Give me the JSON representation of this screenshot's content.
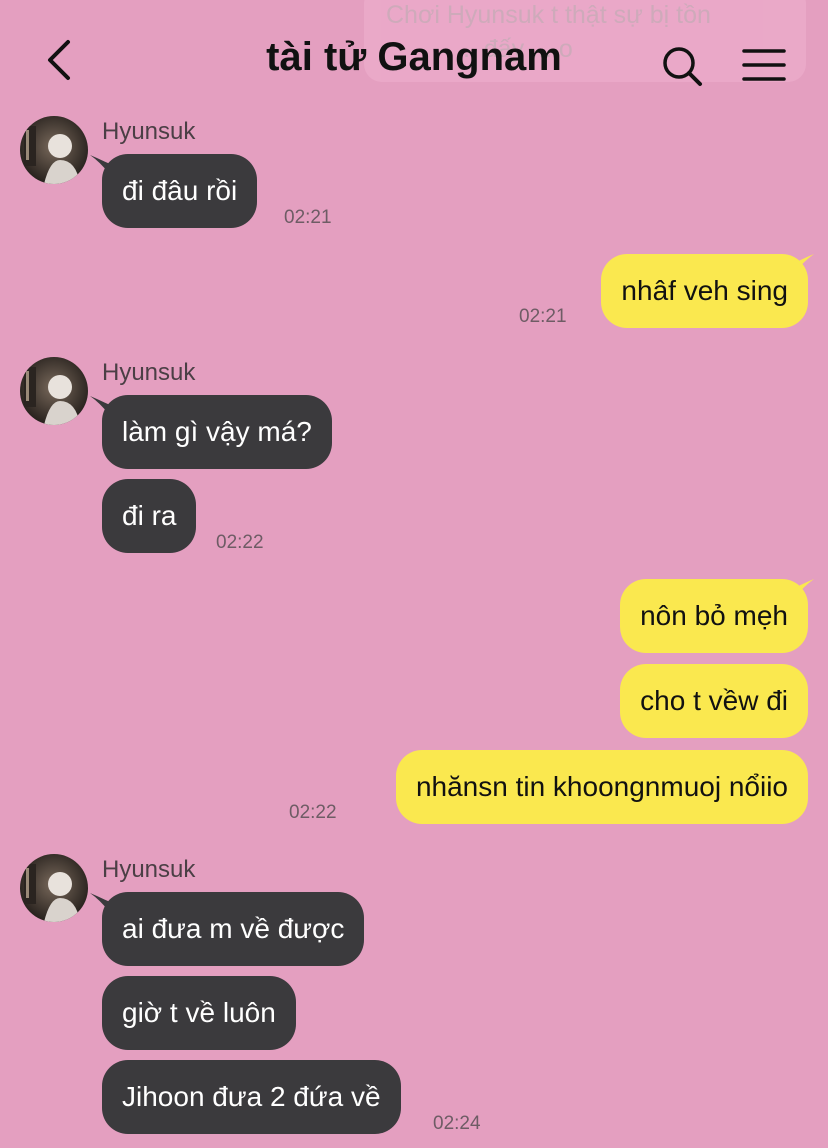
{
  "header": {
    "title": "tài tử Gangnam"
  },
  "notification_ghost": {
    "line1": "Chơi Hyunsuk t thật sự bị tồn",
    "line2": "... đấy ... o"
  },
  "messages": [
    {
      "sender": "Hyunsuk",
      "direction": "in",
      "texts": [
        "đi đâu rồi"
      ],
      "time": "02:21"
    },
    {
      "direction": "out",
      "texts": [
        "nhâf veh sing"
      ],
      "time": "02:21"
    },
    {
      "sender": "Hyunsuk",
      "direction": "in",
      "texts": [
        "làm gì vậy má?",
        "đi ra"
      ],
      "time": "02:22"
    },
    {
      "direction": "out",
      "texts": [
        "nôn bỏ mẹh",
        "cho t vềw đi",
        "nhănsn tin khoongnmuoj nổiio"
      ],
      "time": "02:22"
    },
    {
      "sender": "Hyunsuk",
      "direction": "in",
      "texts": [
        "ai đưa m về được",
        "giờ t về luôn",
        "Jihoon đưa 2 đứa về"
      ],
      "time": "02:24"
    }
  ],
  "colors": {
    "background": "#e49fc0",
    "incoming_bubble": "#3b3a3d",
    "outgoing_bubble": "#fae84f",
    "incoming_text": "#ffffff",
    "outgoing_text": "#111111"
  },
  "icons": [
    "back-chevron-icon",
    "search-icon",
    "menu-icon",
    "avatar-photo"
  ]
}
